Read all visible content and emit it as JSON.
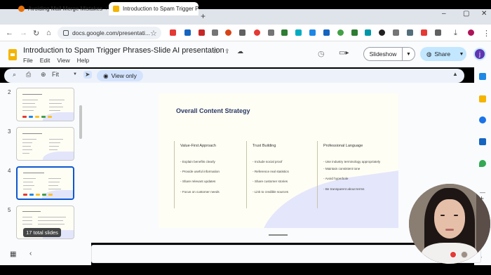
{
  "browser": {
    "tabs": [
      {
        "title": "Avoiding Mail Merge Mistakes",
        "icon_color": "#e8710a"
      },
      {
        "title": "Introduction to Spam Trigger Phrases",
        "icon_color": "#f4b400"
      }
    ],
    "new_tab_glyph": "+",
    "url": "docs.google.com/presentati...",
    "window_controls": [
      "–",
      "▢",
      "✕"
    ]
  },
  "docs": {
    "title": "Introduction to Spam Trigger Phrases-Slide AI presentation",
    "menus": [
      "File",
      "Edit",
      "View",
      "Help"
    ],
    "slideshow_label": "Slideshow",
    "share_label": "Share",
    "avatar_letter": "j",
    "zoom_label": "Fit",
    "view_only_label": "View only"
  },
  "filmstrip": {
    "slides": [
      {
        "number": "2"
      },
      {
        "number": "3"
      },
      {
        "number": "4"
      },
      {
        "number": "5"
      }
    ],
    "total_label": "17 total slides"
  },
  "slide": {
    "title": "Overall Content Strategy",
    "columns": [
      {
        "heading": "Value-First Approach",
        "items": [
          "Explain benefits clearly",
          "Provide useful information",
          "Share relevant updates",
          "Focus on customer needs"
        ]
      },
      {
        "heading": "Trust Building",
        "items": [
          "Include social proof",
          "Reference real statistics",
          "Share customer stories",
          "Link to credible sources"
        ]
      },
      {
        "heading": "Professional Language",
        "items": [
          "Use industry terminology appropriately",
          "Maintain consistent tone",
          "Avoid hyperbole",
          "Be transparent about terms"
        ]
      }
    ]
  },
  "colors": {
    "accent_blue": "#0b57d0",
    "share_bg": "#c2e7ff",
    "docs_yellow": "#f4b400",
    "slide_title": "#2b3a67"
  }
}
